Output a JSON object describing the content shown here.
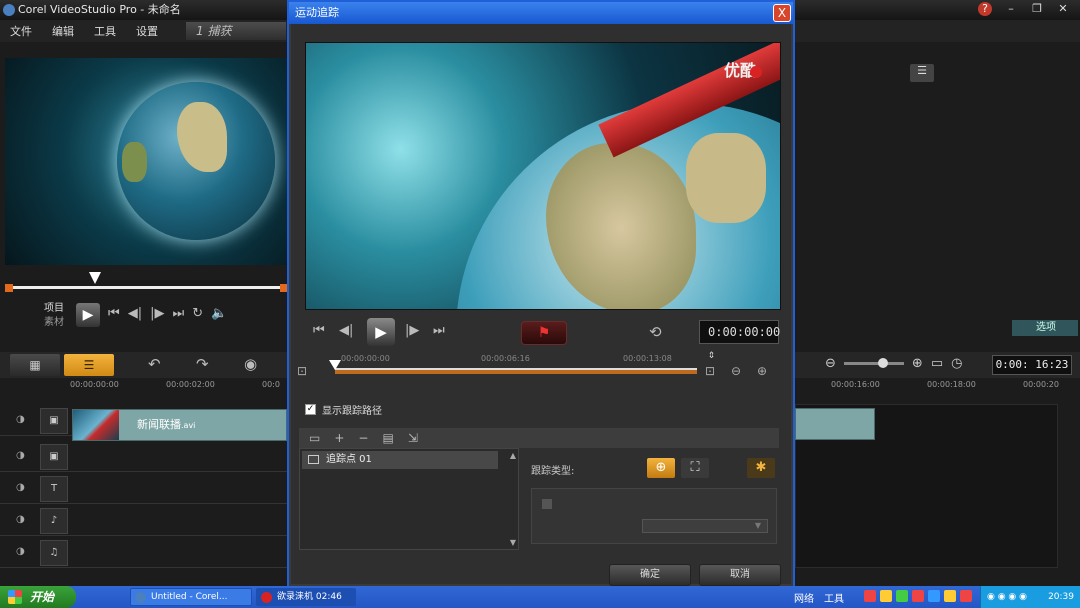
{
  "window": {
    "title": "Corel VideoStudio Pro - 未命名"
  },
  "menu": {
    "items": [
      "文件",
      "编辑",
      "工具",
      "设置"
    ],
    "capture_tab": "1  捕获"
  },
  "left_player": {
    "mode_project": "项目",
    "mode_clip": "素材"
  },
  "timeline": {
    "ruler_left": [
      "00:00:00:00",
      "00:00:02:00",
      "00:0"
    ],
    "ruler_right": [
      "00:00:16:00",
      "00:00:18:00",
      "00:00:20"
    ],
    "clip_label": "新闻联播",
    "clip_ext": ".avi",
    "timecode": "0:00: 16:23"
  },
  "right_panel": {
    "options_tab": "选项"
  },
  "dialog": {
    "title": "运动追踪",
    "close": "X",
    "watermark": "优酷",
    "timecode": "0:00:00:00",
    "ruler": [
      "00:00:00:00",
      "00:00:06:16",
      "00:00:13:08"
    ],
    "show_path_label": "显示跟踪路径",
    "track_item": "追踪点 01",
    "track_type_label": "跟踪类型:",
    "ok": "确定",
    "cancel": "取消"
  },
  "taskbar": {
    "start": "开始",
    "tasks": [
      "Untitled - Corel...",
      "欲录涞机 02:46"
    ],
    "tray_items": [
      "网络",
      "工具"
    ],
    "clock": "20:39"
  }
}
